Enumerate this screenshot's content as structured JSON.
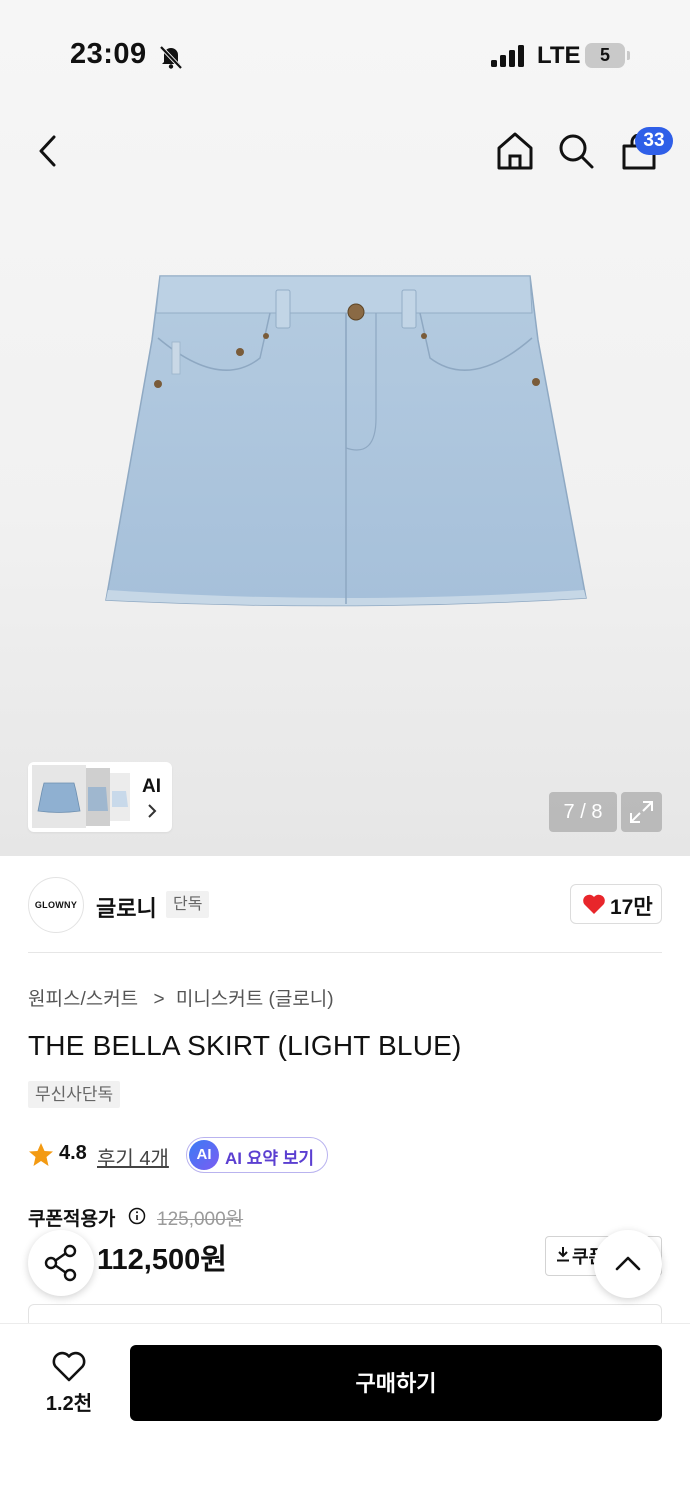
{
  "status_bar": {
    "time": "23:09",
    "network": "LTE",
    "battery": "5"
  },
  "nav": {
    "cart_count": "33"
  },
  "gallery": {
    "ai_label": "AI",
    "counter": "7 / 8"
  },
  "brand": {
    "logo_text": "GLOWNY",
    "name": "글로니",
    "tag": "단독",
    "likes": "17만"
  },
  "product": {
    "breadcrumb_category": "원피스/스커트",
    "breadcrumb_sep": ">",
    "breadcrumb_sub": "미니스커트 (글로니)",
    "title": "THE BELLA SKIRT (LIGHT BLUE)",
    "badge": "무신사단독",
    "rating": "4.8",
    "reviews": "후기 4개",
    "ai_icon_text": "AI",
    "ai_summary": "AI 요약 보기",
    "coupon_label": "쿠폰적용가",
    "original_price": "125,000원",
    "price": "112,500원",
    "coupon_button": "쿠폰"
  },
  "bottom": {
    "wish_count": "1.2천",
    "buy_label": "구매하기"
  },
  "colors": {
    "accent_blue": "#2f5fe8",
    "heart_red": "#e8262b",
    "star_orange": "#f39a12",
    "ai_purple": "#5b3fd1",
    "denim": "#a9c3dc"
  }
}
